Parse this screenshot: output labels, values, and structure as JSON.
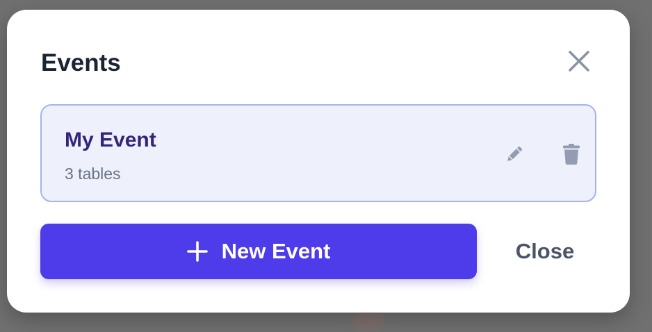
{
  "modal": {
    "title": "Events",
    "close_icon": "close-icon"
  },
  "events": [
    {
      "name": "My Event",
      "subtitle": "3 tables",
      "edit_icon": "pencil-icon",
      "delete_icon": "trash-icon"
    }
  ],
  "actions": {
    "new_event_label": "New Event",
    "new_event_icon": "plus-icon",
    "close_label": "Close"
  },
  "colors": {
    "accent": "#4e3be9",
    "card_background": "#eef0fc",
    "card_border": "#a6b1f3",
    "event_name": "#34257c",
    "muted_icon": "#939cb0"
  }
}
